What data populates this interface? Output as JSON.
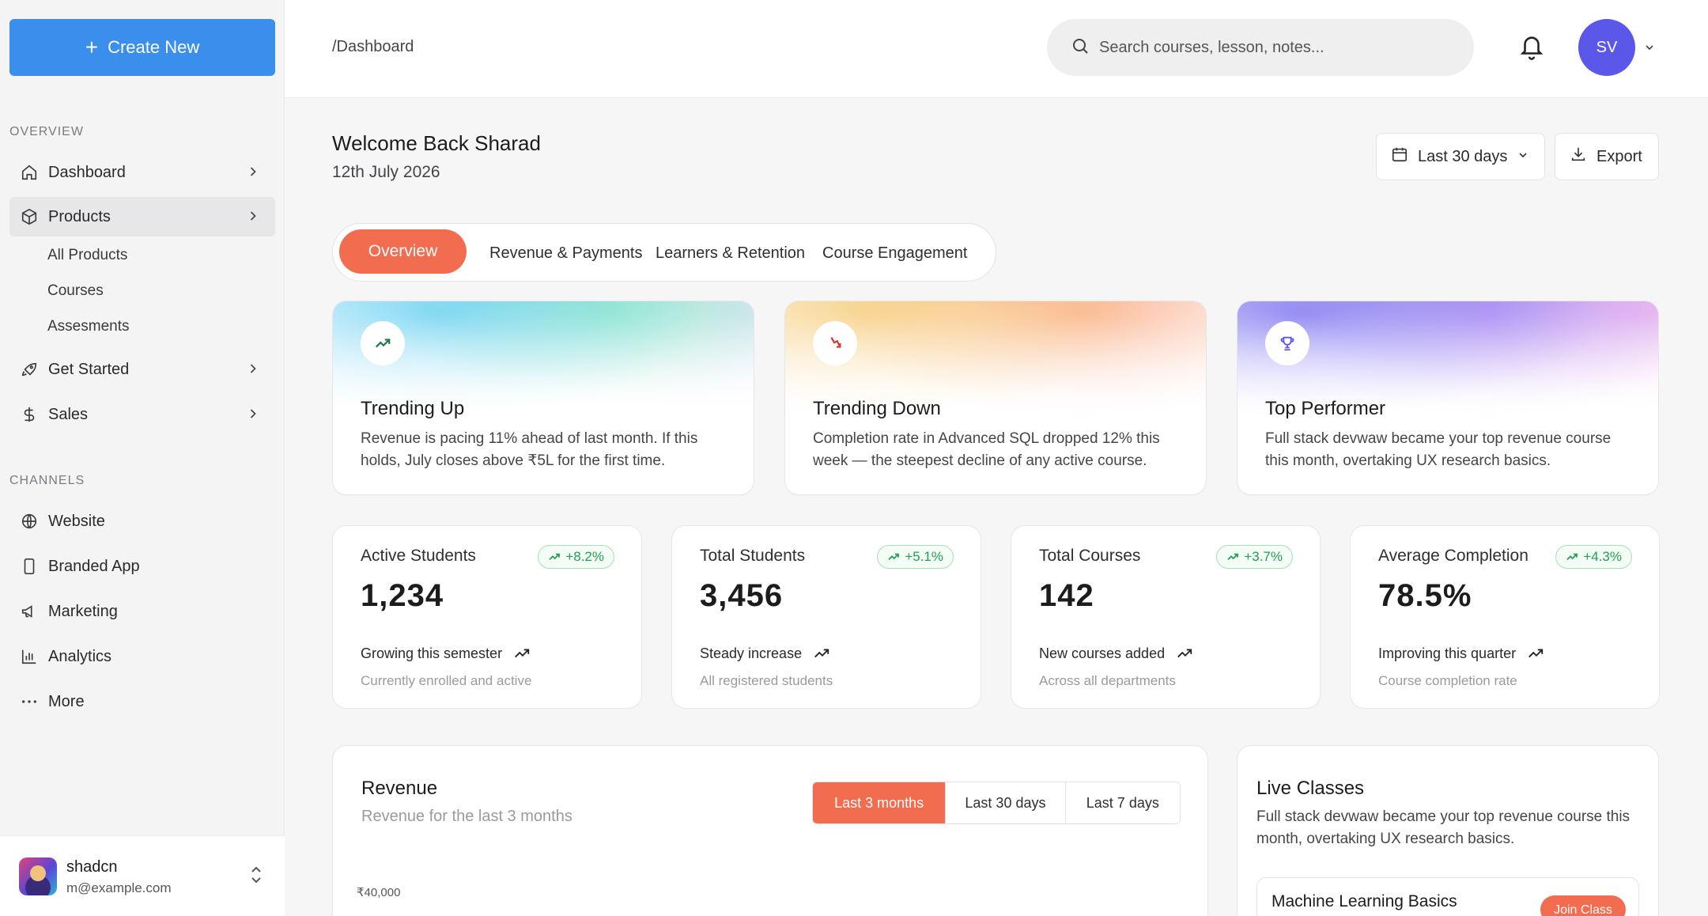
{
  "sidebar": {
    "create_label": "Create New",
    "overview_label": "OVERVIEW",
    "items": [
      {
        "label": "Dashboard",
        "icon": "home-icon"
      },
      {
        "label": "Products",
        "icon": "box-icon"
      },
      {
        "label": "Get Started",
        "icon": "rocket-icon"
      },
      {
        "label": "Sales",
        "icon": "dollar-icon"
      }
    ],
    "products_sub": [
      "All Products",
      "Courses",
      "Assesments"
    ],
    "channels_label": "CHANNELS",
    "channels": [
      {
        "label": "Website",
        "icon": "globe-icon"
      },
      {
        "label": "Branded App",
        "icon": "smartphone-icon"
      },
      {
        "label": "Marketing",
        "icon": "megaphone-icon"
      },
      {
        "label": "Analytics",
        "icon": "bar-chart-icon"
      },
      {
        "label": "More",
        "icon": "more-dots-icon"
      }
    ],
    "user": {
      "name": "shadcn",
      "email": "m@example.com"
    }
  },
  "header": {
    "breadcrumb": "/Dashboard",
    "search_placeholder": "Search courses, lesson, notes...",
    "avatar_initials": "SV",
    "avatar_color": "#5b57e8"
  },
  "main": {
    "welcome": "Welcome Back Sharad",
    "date": "12th July 2026",
    "range_label": "Last 30 days",
    "export_label": "Export",
    "accent": "#f26d4f",
    "tabs": [
      "Overview",
      "Revenue & Payments",
      "Learners & Retention",
      "Course Engagement"
    ],
    "insights": [
      {
        "title": "Trending Up",
        "text": "Revenue is pacing 11% ahead of last month. If this holds, July closes above ₹5L for the first time.",
        "icon": "trending-up-icon"
      },
      {
        "title": "Trending Down",
        "text": "Completion rate in Advanced SQL dropped 12% this week — the steepest decline of any active course.",
        "icon": "trending-down-icon"
      },
      {
        "title": "Top Performer",
        "text": "Full stack devwaw became your top revenue course this month, overtaking UX research basics.",
        "icon": "trophy-icon"
      }
    ],
    "stats": [
      {
        "label": "Active Students",
        "badge": "+8.2%",
        "value": "1,234",
        "note": "Growing this semester",
        "sub": "Currently enrolled and active"
      },
      {
        "label": "Total Students",
        "badge": "+5.1%",
        "value": "3,456",
        "note": "Steady increase",
        "sub": "All registered students"
      },
      {
        "label": "Total Courses",
        "badge": "+3.7%",
        "value": "142",
        "note": "New courses added",
        "sub": "Across all departments"
      },
      {
        "label": "Average Completion",
        "badge": "+4.3%",
        "value": "78.5%",
        "note": "Improving this quarter",
        "sub": "Course completion rate"
      }
    ],
    "revenue": {
      "title": "Revenue",
      "subtitle": "Revenue for the last 3 months",
      "ranges": [
        "Last 3 months",
        "Last 30 days",
        "Last 7 days"
      ],
      "ytick": "₹40,000"
    },
    "live": {
      "title": "Live Classes",
      "text": "Full stack devwaw became your top revenue course this month, overtaking UX research basics.",
      "class_name": "Machine Learning Basics",
      "join_label": "Join Class"
    }
  }
}
